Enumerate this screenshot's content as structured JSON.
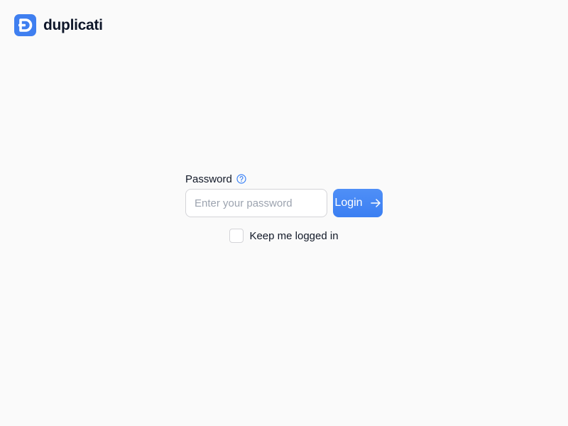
{
  "app": {
    "name": "duplicati",
    "logo_icon": "duplicati-logo-icon",
    "accent_color": "#3b82f6"
  },
  "login": {
    "password_label": "Password",
    "password_help_icon": "question-circle-icon",
    "password_placeholder": "Enter your password",
    "password_value": "",
    "login_button_label": "Login",
    "login_button_icon": "arrow-right-icon",
    "remember_label": "Keep me logged in",
    "remember_checked": false
  }
}
